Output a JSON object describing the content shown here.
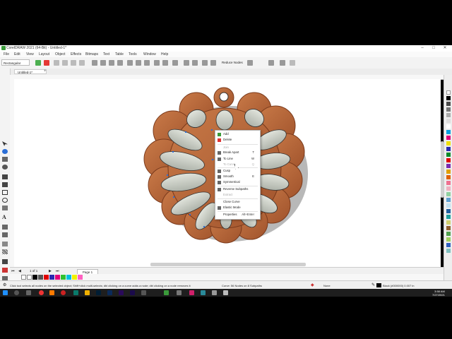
{
  "app": {
    "title": "CorelDRAW 2021 (64-Bit) - Untitled-1*"
  },
  "menu": [
    "File",
    "Edit",
    "View",
    "Layout",
    "Object",
    "Effects",
    "Bitmaps",
    "Text",
    "Table",
    "Tools",
    "Window",
    "Help"
  ],
  "toolbar": {
    "selector": "Rectangular",
    "reduce_nodes_label": "Reduce Nodes"
  },
  "document_tab": "Untitled-1*",
  "context_menu": {
    "items": [
      {
        "label": "Add",
        "shortcut": "",
        "disabled": false
      },
      {
        "label": "Delete",
        "shortcut": "",
        "disabled": false
      },
      {
        "label": "Join",
        "shortcut": "",
        "disabled": true
      },
      {
        "label": "Break Apart",
        "shortcut": "T",
        "disabled": false
      },
      {
        "label": "To Line",
        "shortcut": "W",
        "disabled": false
      },
      {
        "label": "To Curve",
        "shortcut": "Q",
        "disabled": true
      },
      {
        "label": "Cusp",
        "shortcut": "",
        "disabled": false
      },
      {
        "label": "Smooth",
        "shortcut": "E",
        "disabled": false
      },
      {
        "label": "Symmetrical",
        "shortcut": "",
        "disabled": false
      },
      {
        "label": "Reverse Subpaths",
        "shortcut": "",
        "disabled": false
      },
      {
        "label": "Extract",
        "shortcut": "",
        "disabled": true
      },
      {
        "label": "Close Curve",
        "shortcut": "",
        "disabled": false
      },
      {
        "label": "Elastic Mode",
        "shortcut": "",
        "disabled": false
      },
      {
        "label": "Properties",
        "shortcut": "Alt+Enter",
        "disabled": false
      }
    ]
  },
  "page_nav": {
    "counter": "1 of 1",
    "page_tab": "Page 1"
  },
  "status": {
    "hint": "Click tool selects all nodes on the selected object; Shift+click multi-selects; dbl clicking on a curve adds a node; dbl clicking on a node removes it",
    "object_info": "Curve: 56 Nodes on 8 Subpaths",
    "fill": "None",
    "outline": "Black (#000000)  0.007 in"
  },
  "taskbar": {
    "time": "3:58 AM",
    "date": "7/27/2021"
  },
  "colors": {
    "wood": "#b9683a",
    "wood_dark": "#8a4424",
    "inner": "#c8ccc4",
    "accent": "#3a9a3a"
  }
}
